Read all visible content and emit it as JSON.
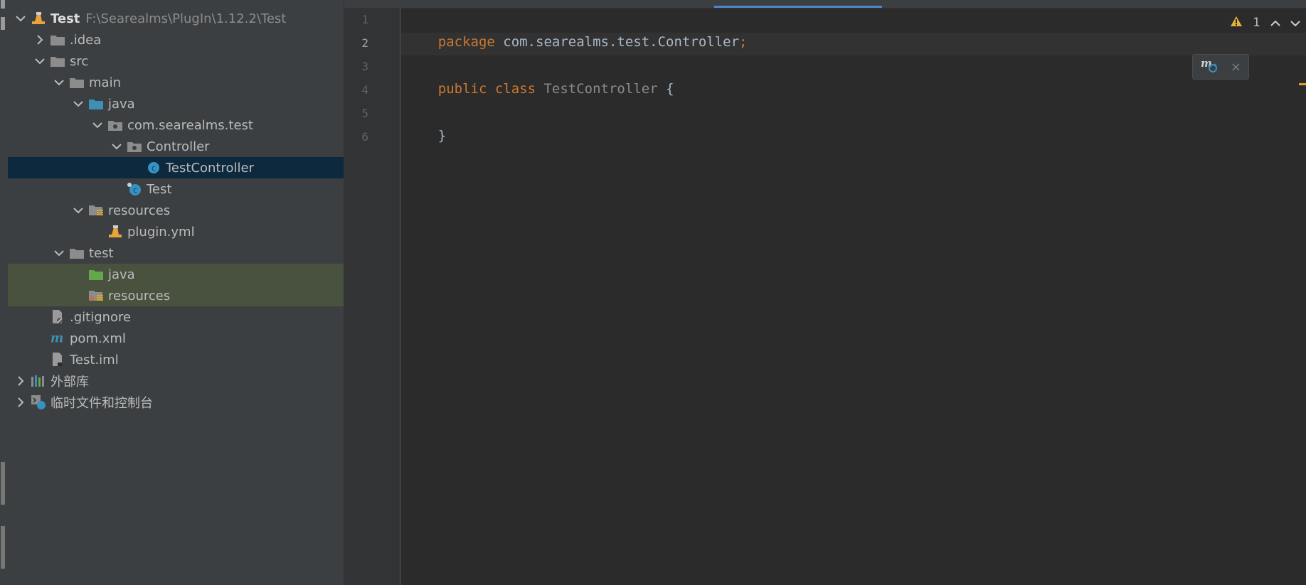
{
  "project_tree": {
    "rows": [
      {
        "label": "Test",
        "path": "F:\\Searealms\\PlugIn\\1.12.2\\Test",
        "icon": "plugin-module-icon",
        "arrow": "down",
        "bold": true
      },
      {
        "label": ".idea",
        "icon": "folder-icon",
        "arrow": "right"
      },
      {
        "label": "src",
        "icon": "folder-icon",
        "arrow": "down"
      },
      {
        "label": "main",
        "icon": "folder-icon",
        "arrow": "down"
      },
      {
        "label": "java",
        "icon": "source-folder-icon",
        "arrow": "down"
      },
      {
        "label": "com.searealms.test",
        "icon": "package-icon",
        "arrow": "down"
      },
      {
        "label": "Controller",
        "icon": "package-icon",
        "arrow": "down"
      },
      {
        "label": "TestController",
        "icon": "java-class-icon",
        "arrow": "none",
        "selected": true
      },
      {
        "label": "Test",
        "icon": "java-main-class-icon",
        "arrow": "none"
      },
      {
        "label": "resources",
        "icon": "resources-folder-icon",
        "arrow": "down"
      },
      {
        "label": "plugin.yml",
        "icon": "plugin-yml-icon",
        "arrow": "none"
      },
      {
        "label": "test",
        "icon": "folder-icon",
        "arrow": "down"
      },
      {
        "label": "java",
        "icon": "test-source-folder-icon",
        "arrow": "none",
        "highlight": true
      },
      {
        "label": "resources",
        "icon": "test-resources-folder-icon",
        "arrow": "none",
        "highlight": true
      },
      {
        "label": ".gitignore",
        "icon": "gitignore-file-icon",
        "arrow": "none"
      },
      {
        "label": "pom.xml",
        "icon": "maven-file-icon",
        "arrow": "none"
      },
      {
        "label": "Test.iml",
        "icon": "iml-file-icon",
        "arrow": "none"
      },
      {
        "label": "外部库",
        "icon": "libraries-icon",
        "arrow": "right"
      },
      {
        "label": "临时文件和控制台",
        "icon": "scratches-icon",
        "arrow": "right"
      }
    ]
  },
  "editor": {
    "line_numbers": [
      "1",
      "2",
      "3",
      "4",
      "5",
      "6"
    ],
    "current_line": "2",
    "code": {
      "l1_kw": "package",
      "l1_rest": " com.searealms.test.Controller",
      "l1_semi": ";",
      "l3_kw": "public class",
      "l3_name": " TestController",
      "l3_brace": " {",
      "l5": "}"
    },
    "inspection": {
      "warning_count": "1",
      "icon": "warning-icon"
    },
    "maven_popup": {
      "icon": "maven-reload-icon",
      "close": "×"
    }
  },
  "colors": {
    "keyword": "#cc7832",
    "identifier": "#a9b7c6",
    "selection": "#0d293e",
    "test_source_bg": "#49523f"
  }
}
